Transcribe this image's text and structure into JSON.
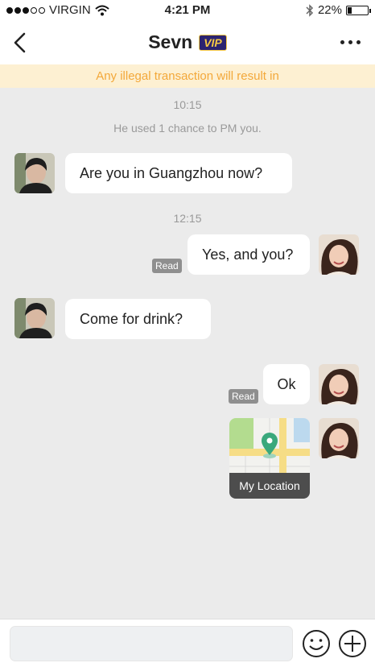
{
  "status_bar": {
    "carrier": "VIRGIN",
    "time": "4:21 PM",
    "battery": "22%",
    "battery_level": 0.22
  },
  "header": {
    "back_icon": "chevron-left-icon",
    "name": "Sevn",
    "badge": "VIP",
    "more_icon": "more-icon"
  },
  "banner": {
    "text": "Any illegal transaction will result in"
  },
  "chat": {
    "time_1": "10:15",
    "system_note": "He used 1 chance to PM you.",
    "msg_1": "Are you in Guangzhou now?",
    "time_2": "12:15",
    "msg_2": "Yes, and you?",
    "msg_2_status": "Read",
    "msg_3": "Come for drink?",
    "msg_4": "Ok",
    "msg_4_status": "Read",
    "location_caption": "My Location"
  },
  "input_bar": {
    "placeholder": "",
    "emoji_icon": "smiley-icon",
    "add_icon": "plus-circle-icon"
  },
  "colors": {
    "banner_bg": "#fdf0d2",
    "banner_text": "#f3a83a",
    "vip_bg": "#2c2470",
    "vip_text": "#f6c945",
    "pin": "#3aa87c"
  }
}
